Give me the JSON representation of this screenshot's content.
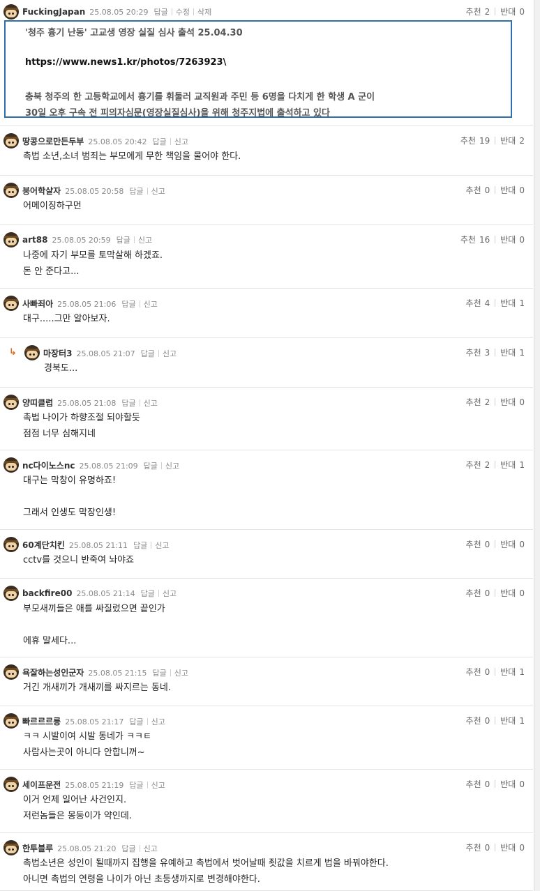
{
  "labels": {
    "reply": "답글",
    "edit": "수정",
    "delete": "삭제",
    "report": "신고",
    "up": "추천",
    "down": "반대"
  },
  "colors": {
    "quote_border": "#2f70a8",
    "reply_arrow": "#e06b1a",
    "text": "#222222",
    "meta": "#888888"
  },
  "reply_arrow_icon": "↳",
  "comments": [
    {
      "nick": "FuckingJapan",
      "date": "25.08.05 20:29",
      "actions": [
        "답글",
        "수정",
        "삭제"
      ],
      "up": "2",
      "down": "0",
      "quote": {
        "title": "'청주 흉기 난동' 고교생 영장 실질 심사 출석 25.04.30",
        "link": "https://www.news1.kr/photos/7263923\\",
        "line1": "충북 청주의 한 고등학교에서 흉기를 휘둘러 교직원과 주민 등 6명을 다치게 한 학생 A 군이",
        "line2": "30일 오후 구속 전 피의자심문(영장실질심사)을 위해 청주지법에 출석하고 있다"
      }
    },
    {
      "nick": "땅콩으로만든두부",
      "date": "25.08.05 20:42",
      "actions": [
        "답글",
        "신고"
      ],
      "up": "19",
      "down": "2",
      "text": "촉법 소년,소녀 범죄는 부모에게 무한 책임을 물어야 한다."
    },
    {
      "nick": "붕어학살자",
      "date": "25.08.05 20:58",
      "actions": [
        "답글",
        "신고"
      ],
      "up": "0",
      "down": "0",
      "text": "어메이징하구먼"
    },
    {
      "nick": "art88",
      "date": "25.08.05 20:59",
      "actions": [
        "답글",
        "신고"
      ],
      "up": "16",
      "down": "0",
      "text": "나중에 자기 부모를 토막살해 하겠죠.\n돈 안 준다고..."
    },
    {
      "nick": "사빠죄아",
      "date": "25.08.05 21:06",
      "actions": [
        "답글",
        "신고"
      ],
      "up": "4",
      "down": "1",
      "text": "대구.....그만 알아보자."
    },
    {
      "nick": "마장터3",
      "date": "25.08.05 21:07",
      "actions": [
        "답글",
        "신고"
      ],
      "up": "3",
      "down": "1",
      "text": "경북도...",
      "reply": true
    },
    {
      "nick": "양띠클럽",
      "date": "25.08.05 21:08",
      "actions": [
        "답글",
        "신고"
      ],
      "up": "2",
      "down": "0",
      "text": "촉법 나이가 하향조절 되야할듯\n점점 너무 심해지네"
    },
    {
      "nick": "nc다이노스nc",
      "date": "25.08.05 21:09",
      "actions": [
        "답글",
        "신고"
      ],
      "up": "2",
      "down": "1",
      "text": "대구는 막창이 유명하죠!\n\n그래서 인생도 막장인생!"
    },
    {
      "nick": "60계단치킨",
      "date": "25.08.05 21:11",
      "actions": [
        "답글",
        "신고"
      ],
      "up": "0",
      "down": "0",
      "text": "cctv를 것으니 반죽여 놔야죠"
    },
    {
      "nick": "backfire00",
      "date": "25.08.05 21:14",
      "actions": [
        "답글",
        "신고"
      ],
      "up": "0",
      "down": "0",
      "text": "부모새끼들은 애를 싸질렀으면 끝인가\n\n에휴 말세다..."
    },
    {
      "nick": "욕잘하는성인군자",
      "date": "25.08.05 21:15",
      "actions": [
        "답글",
        "신고"
      ],
      "up": "0",
      "down": "1",
      "text": "거긴 개새끼가 개새끼를 싸지르는 동네."
    },
    {
      "nick": "빠르르르릉",
      "date": "25.08.05 21:17",
      "actions": [
        "답글",
        "신고"
      ],
      "up": "0",
      "down": "1",
      "text": "ㅋㅋ 시발이여 시발 동네가 ㅋㅋㅌ\n사람사는곳이 아니다 안합니꺼~"
    },
    {
      "nick": "세이프운전",
      "date": "25.08.05 21:19",
      "actions": [
        "답글",
        "신고"
      ],
      "up": "0",
      "down": "0",
      "text": "이거 언제 일어난 사건인지.\n저런놈들은 몽둥이가 약인데."
    },
    {
      "nick": "한투블루",
      "date": "25.08.05 21:20",
      "actions": [
        "답글",
        "신고"
      ],
      "up": "0",
      "down": "0",
      "text": "촉법소년은 성인이 될때까지 집행을 유예하고 촉법에서 벗어날때 죗값을 치르게 법을 바꿔야한다.\n아니면 촉법의 연령을 나이가 아닌 초등생까지로 변경해야한다."
    }
  ]
}
